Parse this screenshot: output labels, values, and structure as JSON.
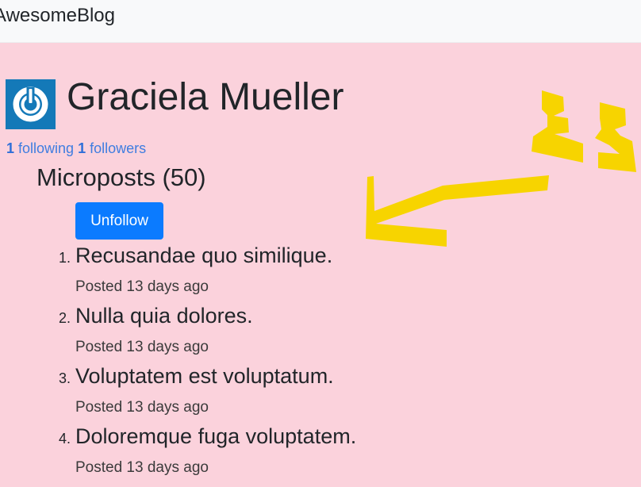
{
  "navbar": {
    "brand": "AwesomeBlog"
  },
  "profile": {
    "name": "Graciela Mueller",
    "avatar_icon": "power-icon",
    "following_count": "1",
    "following_label": "following",
    "followers_count": "1",
    "followers_label": "followers"
  },
  "microposts": {
    "heading": "Microposts (50)",
    "unfollow_label": "Unfollow",
    "posts": [
      {
        "num": "1.",
        "title": "Recusandae quo similique.",
        "meta": "Posted 13 days ago"
      },
      {
        "num": "2.",
        "title": "Nulla quia dolores.",
        "meta": "Posted 13 days ago"
      },
      {
        "num": "3.",
        "title": "Voluptatem est voluptatum.",
        "meta": "Posted 13 days ago"
      },
      {
        "num": "4.",
        "title": "Doloremque fuga voluptatem.",
        "meta": "Posted 13 days ago"
      }
    ]
  },
  "colors": {
    "background": "#fbd2dc",
    "accent": "#0b7bff",
    "link": "#3f7de0",
    "annotation": "#f7d400",
    "avatar_bg": "#1479b8"
  }
}
